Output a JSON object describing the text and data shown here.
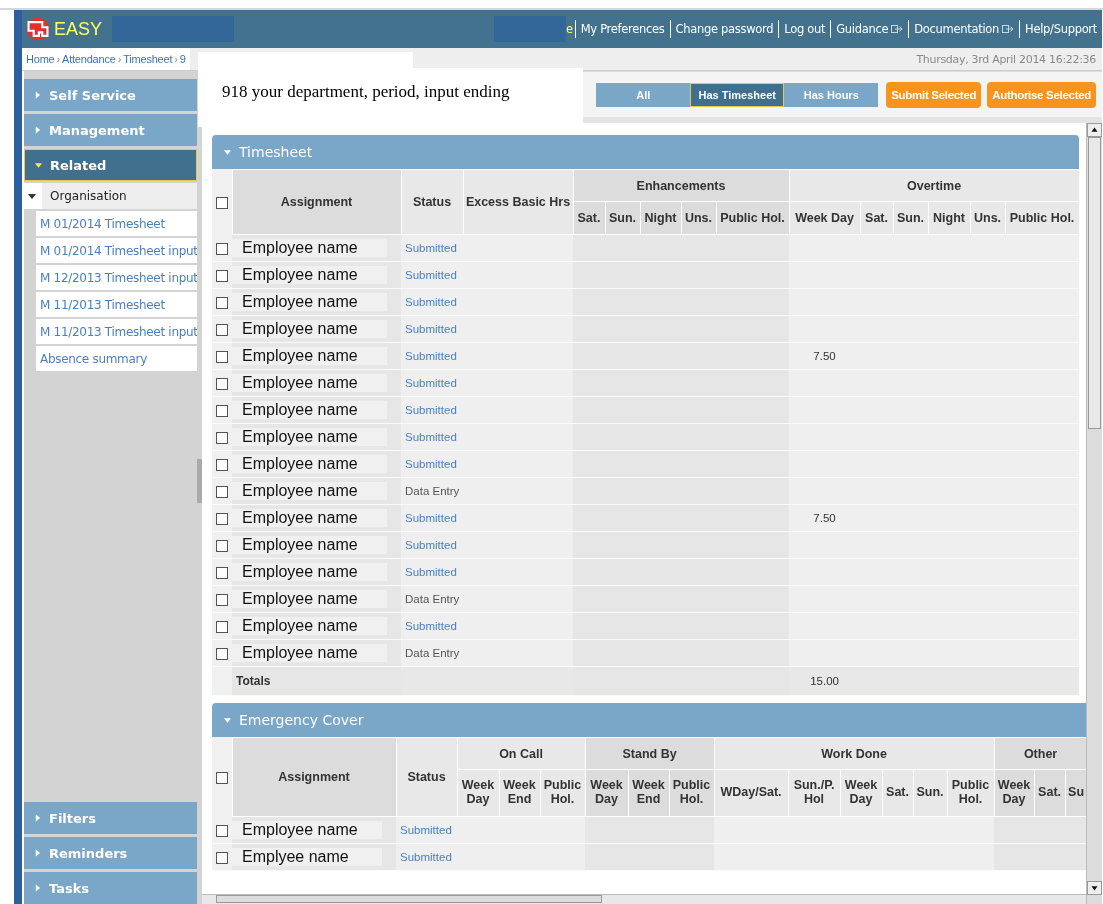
{
  "header": {
    "logo": "EASY",
    "partial_link": "e",
    "links": [
      {
        "label": "My Preferences",
        "external": false
      },
      {
        "label": "Change password",
        "external": false
      },
      {
        "label": "Log out",
        "external": false
      },
      {
        "label": "Guidance",
        "external": true
      },
      {
        "label": "Documentation",
        "external": true
      },
      {
        "label": "Help/Support",
        "external": false
      }
    ]
  },
  "breadcrumb": [
    "Home",
    "Attendance",
    "Timesheet",
    "9"
  ],
  "breadcrumb_separator": "›",
  "overlay_note": "918 your department, period, input ending",
  "date": "Thursday, 3rd April 2014 16:22:36",
  "filters": [
    {
      "label": "All",
      "selected": false
    },
    {
      "label": "Has Timesheet",
      "selected": true
    },
    {
      "label": "Has Hours",
      "selected": false
    }
  ],
  "actions": [
    "Submit Selected",
    "Authorise Selected"
  ],
  "sidebar": {
    "top": [
      {
        "label": "Self Service",
        "expanded": false
      },
      {
        "label": "Management",
        "expanded": false
      },
      {
        "label": "Related",
        "expanded": true,
        "children": [
          {
            "label": "Organisation",
            "expanded": true,
            "children": [
              {
                "label": "M 01/2014 Timesheet"
              },
              {
                "label": "M 01/2014 Timesheet input"
              },
              {
                "label": "M 12/2013 Timesheet input"
              },
              {
                "label": "M 11/2013 Timesheet"
              },
              {
                "label": "M 11/2013 Timesheet input"
              },
              {
                "label": "Absence summary"
              }
            ]
          }
        ]
      }
    ],
    "bottom": [
      {
        "label": "Filters",
        "expanded": false
      },
      {
        "label": "Reminders",
        "expanded": false
      },
      {
        "label": "Tasks",
        "expanded": false
      }
    ]
  },
  "sections": [
    {
      "title": "Timesheet",
      "expanded": true,
      "all_checked": false,
      "columns": [
        "Assignment",
        "Status",
        "Excess Basic Hrs"
      ],
      "groups": [
        {
          "label": "Enhancements",
          "columns": [
            "Sat.",
            "Sun.",
            "Night",
            "Uns.",
            "Public Hol."
          ]
        },
        {
          "label": "Overtime",
          "columns": [
            "Week Day",
            "Sat.",
            "Sun.",
            "Night",
            "Uns.",
            "Public Hol."
          ]
        }
      ],
      "rows": [
        {
          "checked": false,
          "assignment": "Employee name",
          "status": "Submitted",
          "status_link": true
        },
        {
          "checked": false,
          "assignment": "Employee name",
          "status": "Submitted",
          "status_link": true
        },
        {
          "checked": false,
          "assignment": "Employee name",
          "status": "Submitted",
          "status_link": true
        },
        {
          "checked": false,
          "assignment": "Employee name",
          "status": "Submitted",
          "status_link": true
        },
        {
          "checked": false,
          "assignment": "Employee name",
          "status": "Submitted",
          "status_link": true,
          "overtime_week_day": "7.50"
        },
        {
          "checked": false,
          "assignment": "Employee name",
          "status": "Submitted",
          "status_link": true
        },
        {
          "checked": false,
          "assignment": "Employee name",
          "status": "Submitted",
          "status_link": true
        },
        {
          "checked": false,
          "assignment": "Employee name",
          "status": "Submitted",
          "status_link": true
        },
        {
          "checked": false,
          "assignment": "Employee name",
          "status": "Submitted",
          "status_link": true
        },
        {
          "checked": false,
          "assignment": "Employee name",
          "status": "Data Entry",
          "status_link": false
        },
        {
          "checked": false,
          "assignment": "Employee name",
          "status": "Submitted",
          "status_link": true,
          "overtime_week_day": "7.50"
        },
        {
          "checked": false,
          "assignment": "Employee name",
          "status": "Submitted",
          "status_link": true
        },
        {
          "checked": false,
          "assignment": "Employee name",
          "status": "Submitted",
          "status_link": true
        },
        {
          "checked": false,
          "assignment": "Employee name",
          "status": "Data Entry",
          "status_link": false
        },
        {
          "checked": false,
          "assignment": "Employee name",
          "status": "Submitted",
          "status_link": true
        },
        {
          "checked": false,
          "assignment": "Employee name",
          "status": "Data Entry",
          "status_link": false
        }
      ],
      "totals": {
        "label": "Totals",
        "overtime_week_day": "15.00"
      }
    },
    {
      "title": "Emergency Cover",
      "expanded": true,
      "all_checked": false,
      "columns": [
        "Assignment",
        "Status"
      ],
      "groups": [
        {
          "label": "On Call",
          "columns": [
            "Week Day",
            "Week End",
            "Public Hol."
          ]
        },
        {
          "label": "Stand By",
          "columns": [
            "Week Day",
            "Week End",
            "Public Hol."
          ]
        },
        {
          "label": "Work Done",
          "columns": [
            "WDay/Sat.",
            "Sun./P. Hol",
            "Week Day",
            "Sat.",
            "Sun.",
            "Public Hol."
          ]
        },
        {
          "label": "Other",
          "columns": [
            "Week Day",
            "Sat.",
            "Su"
          ]
        }
      ],
      "rows": [
        {
          "checked": false,
          "assignment": "Employee name",
          "status": "Submitted",
          "status_link": true
        },
        {
          "checked": false,
          "assignment": "Emplyee name",
          "status": "Submitted",
          "status_link": true
        }
      ]
    }
  ]
}
